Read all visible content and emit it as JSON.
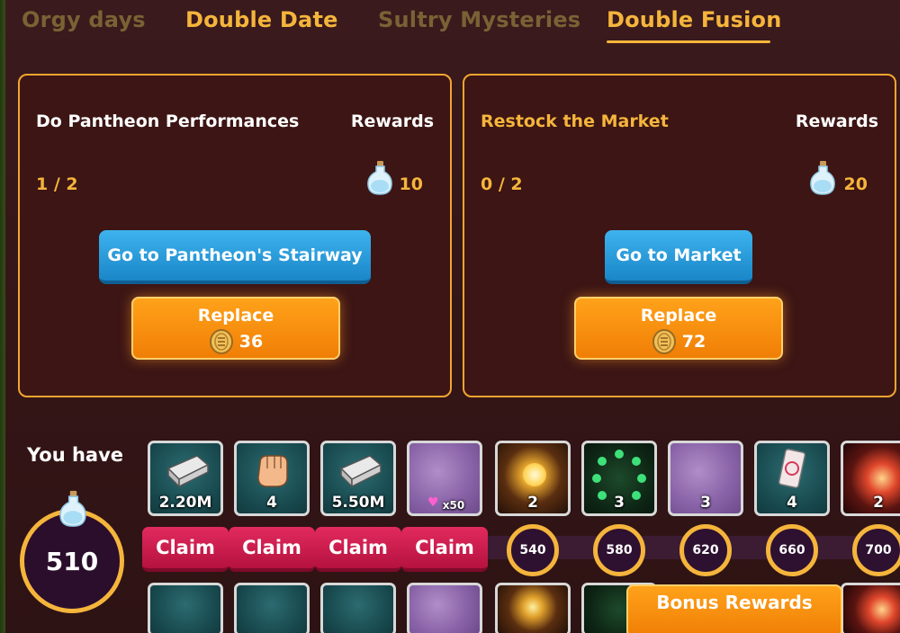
{
  "tabs": [
    {
      "label": "Orgy days",
      "active": false
    },
    {
      "label": "Double Date",
      "active": false
    },
    {
      "label": "Sultry Mysteries",
      "active": false
    },
    {
      "label": "Double Fusion",
      "active": true
    }
  ],
  "tasks": [
    {
      "title": "Do Pantheon Performances",
      "rewards_label": "Rewards",
      "progress": "1 / 2",
      "reward_amount": "10",
      "go_label": "Go to Pantheon's Stairway",
      "replace_label": "Replace",
      "replace_cost": "36"
    },
    {
      "title": "Restock the Market",
      "rewards_label": "Rewards",
      "progress": "0 / 2",
      "reward_amount": "20",
      "go_label": "Go to Market",
      "replace_label": "Replace",
      "replace_cost": "72"
    }
  ],
  "wallet": {
    "label": "You have",
    "amount": "510"
  },
  "rewards_track": {
    "tiles": [
      {
        "icon": "money-stack-icon",
        "qty": "2.20M"
      },
      {
        "icon": "fist-icon",
        "qty": "4"
      },
      {
        "icon": "money-stack-icon",
        "qty": "5.50M"
      },
      {
        "icon": "hearts-icon",
        "qty": "x50"
      },
      {
        "icon": "golden-orb-icon",
        "qty": "2"
      },
      {
        "icon": "green-orbs-icon",
        "qty": "3"
      },
      {
        "icon": "purple-item-icon",
        "qty": "3"
      },
      {
        "icon": "ticket-icon",
        "qty": "4"
      },
      {
        "icon": "red-orb-icon",
        "qty": "2"
      }
    ],
    "claim_label": "Claim",
    "claims": [
      "Claim",
      "Claim",
      "Claim",
      "Claim"
    ],
    "milestones": [
      "540",
      "580",
      "620",
      "660",
      "700"
    ],
    "bonus_label": "Bonus Rewards"
  },
  "colors": {
    "accent": "#f5b53c",
    "claim": "#d01f52",
    "go": "#1e90d0",
    "replace": "#f7900f"
  }
}
